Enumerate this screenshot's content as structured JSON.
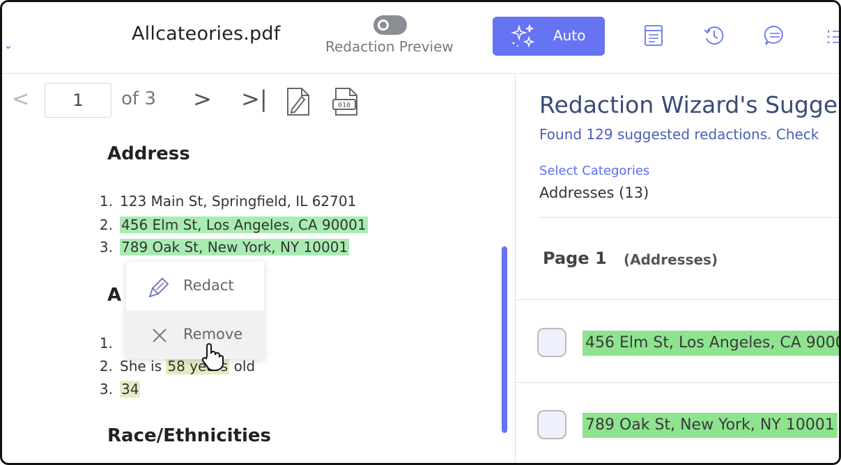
{
  "header": {
    "doc_title": "Allcateories.pdf",
    "preview_label": "Redaction Preview",
    "auto_label": "Auto",
    "icons": [
      "chevron-down-icon",
      "toggle-icon",
      "sparkle-icon",
      "document-icon",
      "history-icon",
      "comment-icon",
      "list-icon"
    ]
  },
  "pager": {
    "current_page": "1",
    "of_label": "of 3",
    "icons": [
      "chevron-left-icon",
      "chevron-right-icon",
      "last-page-icon",
      "redact-pen-icon",
      "binary-file-icon"
    ]
  },
  "document": {
    "address_heading": "Address",
    "addresses": [
      {
        "num": "1.",
        "text": "123 Main St, Springfield, IL 62701"
      },
      {
        "num": "2.",
        "text": "456 Elm St, Los Angeles, CA 90001"
      },
      {
        "num": "3.",
        "text": "789 Oak St, New York, NY 10001"
      }
    ],
    "age_heading_partial": "A",
    "ages": [
      {
        "num": "1.",
        "text": ""
      },
      {
        "num": "2.",
        "prefix": "She is ",
        "highlight": "58 years",
        "suffix": " old"
      },
      {
        "num": "3.",
        "highlight": "34"
      }
    ],
    "race_heading": "Race/Ethnicities"
  },
  "context_menu": {
    "redact_label": "Redact",
    "remove_label": "Remove"
  },
  "panel": {
    "title": "Redaction Wizard's Suggest",
    "found_text": "Found 129 suggested redactions. Check",
    "select_categories_label": "Select Categories",
    "category_value": "Addresses (13)",
    "page_label": "Page 1",
    "page_category": "(Addresses)",
    "suggestions": [
      {
        "text": "456 Elm St, Los Angeles, CA 9000",
        "checked": false
      },
      {
        "text": "789 Oak St, New York, NY 10001",
        "checked": false
      }
    ]
  },
  "colors": {
    "accent": "#6673f2",
    "highlight_green": "#a9ecb2",
    "suggestion_green": "#8ee38f",
    "title_navy": "#3a4a78"
  }
}
